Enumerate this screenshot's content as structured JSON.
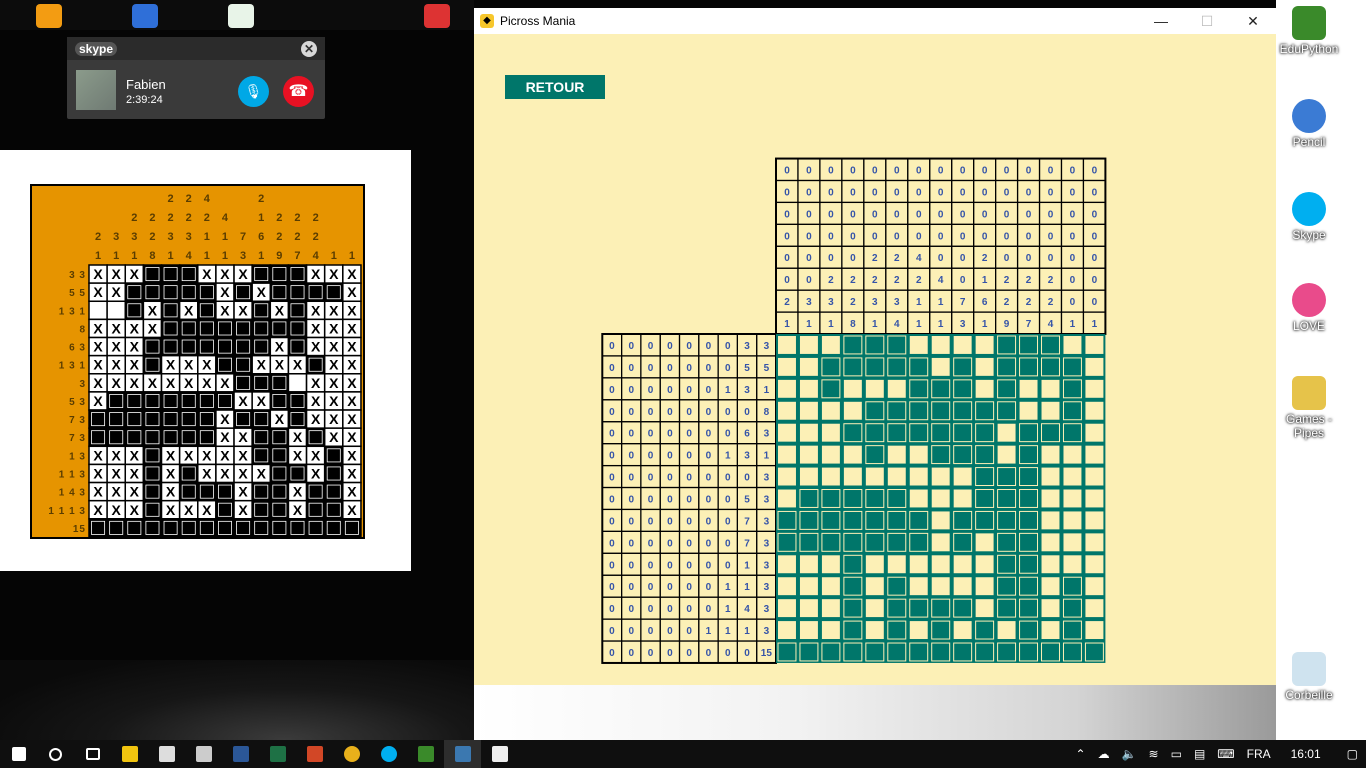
{
  "skype": {
    "logo": "skype",
    "caller": "Fabien",
    "duration": "2:39:24"
  },
  "desktop_icons": [
    {
      "label": "EduPython",
      "color": "#3a8a2a"
    },
    {
      "label": "Pencil",
      "color": "#3b7bd4"
    },
    {
      "label": "Skype",
      "color": "#00aff0"
    },
    {
      "label": "LOVE",
      "color": "#e94b8b"
    },
    {
      "label": "Games - Pipes",
      "color": "#e6c34a"
    },
    {
      "label": "Corbeille",
      "color": "#cfe3ef"
    }
  ],
  "window": {
    "title": "Picross Mania",
    "retour": "RETOUR"
  },
  "puzzle": {
    "size": 15,
    "col_clues": [
      [
        "0",
        "0",
        "0",
        "0",
        "0",
        "0",
        "0",
        "0",
        "0",
        "0",
        "0",
        "0",
        "0",
        "0",
        "0"
      ],
      [
        "0",
        "0",
        "0",
        "0",
        "0",
        "0",
        "0",
        "0",
        "0",
        "0",
        "0",
        "0",
        "0",
        "0",
        "0"
      ],
      [
        "0",
        "0",
        "0",
        "0",
        "0",
        "0",
        "0",
        "0",
        "0",
        "0",
        "0",
        "0",
        "0",
        "0",
        "0"
      ],
      [
        "0",
        "0",
        "0",
        "0",
        "0",
        "0",
        "0",
        "0",
        "0",
        "0",
        "0",
        "0",
        "0",
        "0",
        "0"
      ],
      [
        "0",
        "0",
        "0",
        "0",
        "2",
        "2",
        "4",
        "0",
        "0",
        "2",
        "0",
        "0",
        "0",
        "0",
        "0"
      ],
      [
        "0",
        "0",
        "2",
        "2",
        "2",
        "2",
        "2",
        "4",
        "0",
        "1",
        "2",
        "2",
        "2",
        "0",
        "0"
      ],
      [
        "2",
        "3",
        "3",
        "2",
        "3",
        "3",
        "1",
        "1",
        "7",
        "6",
        "2",
        "2",
        "2",
        "0",
        "0"
      ],
      [
        "1",
        "1",
        "1",
        "8",
        "1",
        "4",
        "1",
        "1",
        "3",
        "1",
        "9",
        "7",
        "4",
        "1",
        "1"
      ]
    ],
    "row_clues": [
      [
        "0",
        "0",
        "0",
        "0",
        "0",
        "0",
        "0",
        "3",
        "3"
      ],
      [
        "0",
        "0",
        "0",
        "0",
        "0",
        "0",
        "0",
        "5",
        "5"
      ],
      [
        "0",
        "0",
        "0",
        "0",
        "0",
        "0",
        "1",
        "3",
        "1"
      ],
      [
        "0",
        "0",
        "0",
        "0",
        "0",
        "0",
        "0",
        "0",
        "8"
      ],
      [
        "0",
        "0",
        "0",
        "0",
        "0",
        "0",
        "0",
        "6",
        "3"
      ],
      [
        "0",
        "0",
        "0",
        "0",
        "0",
        "0",
        "1",
        "3",
        "1"
      ],
      [
        "0",
        "0",
        "0",
        "0",
        "0",
        "0",
        "0",
        "0",
        "3"
      ],
      [
        "0",
        "0",
        "0",
        "0",
        "0",
        "0",
        "0",
        "5",
        "3"
      ],
      [
        "0",
        "0",
        "0",
        "0",
        "0",
        "0",
        "0",
        "7",
        "3"
      ],
      [
        "0",
        "0",
        "0",
        "0",
        "0",
        "0",
        "0",
        "7",
        "3"
      ],
      [
        "0",
        "0",
        "0",
        "0",
        "0",
        "0",
        "0",
        "1",
        "3"
      ],
      [
        "0",
        "0",
        "0",
        "0",
        "0",
        "0",
        "1",
        "1",
        "3"
      ],
      [
        "0",
        "0",
        "0",
        "0",
        "0",
        "0",
        "1",
        "4",
        "3"
      ],
      [
        "0",
        "0",
        "0",
        "0",
        "0",
        "1",
        "1",
        "1",
        "3"
      ],
      [
        "0",
        "0",
        "0",
        "0",
        "0",
        "0",
        "0",
        "0",
        "15"
      ]
    ],
    "filled": [
      "000111000011100",
      "001111101011110",
      "001000111010010",
      "000011111110010",
      "000111111101110",
      "000010011101000",
      "000000000111000",
      "011111000111000",
      "111111101111000",
      "111111101011000",
      "000100000011000",
      "000101000011010",
      "000101111011010",
      "000101010101010",
      "111111111111111"
    ]
  },
  "reference": {
    "col_clue_rows": [
      [
        "",
        "",
        "",
        "",
        "2",
        "2",
        "4",
        "",
        "",
        "2",
        "",
        "",
        "",
        "",
        ""
      ],
      [
        "",
        "",
        "2",
        "2",
        "2",
        "2",
        "2",
        "4",
        "",
        "1",
        "2",
        "2",
        "2",
        "",
        ""
      ],
      [
        "2",
        "3",
        "3",
        "2",
        "3",
        "3",
        "1",
        "1",
        "7",
        "6",
        "2",
        "2",
        "2",
        "",
        ""
      ],
      [
        "1",
        "1",
        "1",
        "8",
        "1",
        "4",
        "1",
        "1",
        "3",
        "1",
        "9",
        "7",
        "4",
        "1",
        "1"
      ]
    ],
    "row_clues": [
      "3 3",
      "5 5",
      "1 3 1",
      "8",
      "6 3",
      "1 3 1",
      "3",
      "5 3",
      "7 3",
      "7 3",
      "1 3",
      "1 1 3",
      "1 4 3",
      "1 1 1 3",
      "15"
    ],
    "cells": [
      "xxx...xxx...xxx",
      "xx.....x.x....x",
      "oo.x.x.xx.x.xxx",
      "xxxx........xxx",
      "xxx.......x.xxx",
      "xxx.xxx..xxx.xx",
      "xxxxxxxx...oxxx",
      "x.......xx..xxx",
      ".......x..x.xxx",
      ".......xx..x.xx",
      "xxx.xxxxx..xx.x",
      "xxx.x.xxxx..x.x",
      "xxx.x...x..x..x",
      "xxx.xxx.x..x..x",
      "..............."
    ]
  },
  "taskbar": {
    "lang": "FRA",
    "clock": "16:01"
  }
}
